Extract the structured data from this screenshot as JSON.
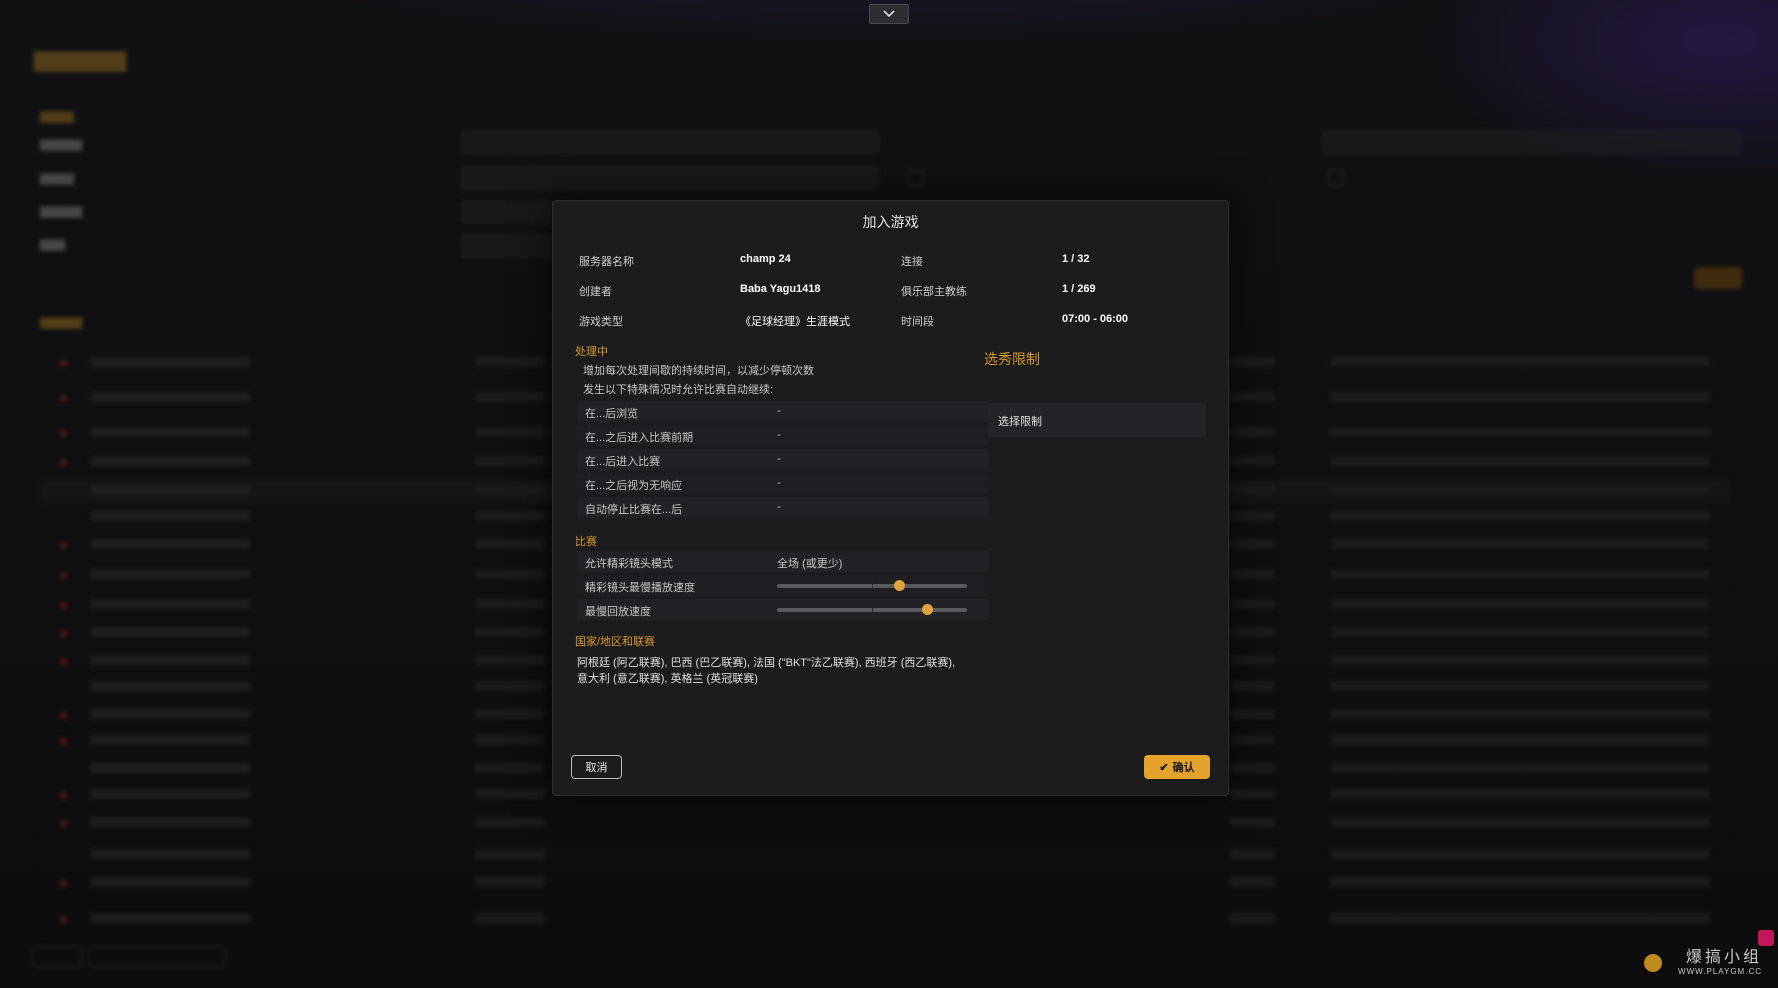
{
  "top_collapse": {
    "icon": "chevron-down-icon",
    "glyph": "⌄"
  },
  "dialog": {
    "title": "加入游戏",
    "info": [
      {
        "label": "服务器名称",
        "value": "champ 24",
        "label2": "连接",
        "value2": "1 / 32"
      },
      {
        "label": "创建者",
        "value": "Baba Yagu1418",
        "label2": "俱乐部主教练",
        "value2": "1 / 269"
      },
      {
        "label": "游戏类型",
        "value": "《足球经理》生涯模式",
        "label2": "时间段",
        "value2": "07:00 - 06:00"
      }
    ],
    "processing": {
      "heading": "处理中",
      "desc1": "增加每次处理间歇的持续时间，以减少停顿次数",
      "desc2": "发生以下特殊情况时允许比赛自动继续:",
      "rows": [
        {
          "label": "在...后浏览",
          "value": "-"
        },
        {
          "label": "在...之后进入比赛前期",
          "value": "-"
        },
        {
          "label": "在...后进入比赛",
          "value": "-"
        },
        {
          "label": "在...之后视为无响应",
          "value": "-"
        },
        {
          "label": "自动停止比赛在...后",
          "value": "-"
        }
      ]
    },
    "match": {
      "heading": "比赛",
      "highlight_mode_label": "允许精彩镜头模式",
      "highlight_mode_value": "全场 (或更少)",
      "highlight_speed_label": "精彩镜头最慢播放速度",
      "highlight_speed_level": 0.64,
      "replay_speed_label": "最慢回放速度",
      "replay_speed_level": 0.79
    },
    "nations": {
      "heading": "国家/地区和联赛",
      "text_line1": "阿根廷 (阿乙联赛), 巴西 (巴乙联赛), 法国 (\"BKT\"法乙联赛), 西班牙 (西乙联赛),",
      "text_line2": "意大利 (意乙联赛), 英格兰 (英冠联赛)"
    },
    "draft": {
      "heading": "选秀限制",
      "box_label": "选择限制"
    },
    "cancel_label": "取消",
    "confirm_label": "确认",
    "confirm_icon": "✔"
  },
  "watermark": {
    "main": "爆搞小组",
    "sub": "WWW.PLAYGM.CC"
  },
  "colors": {
    "accent": "#e3a32c",
    "background": "#141316",
    "dialog": "#1c1b1e"
  }
}
